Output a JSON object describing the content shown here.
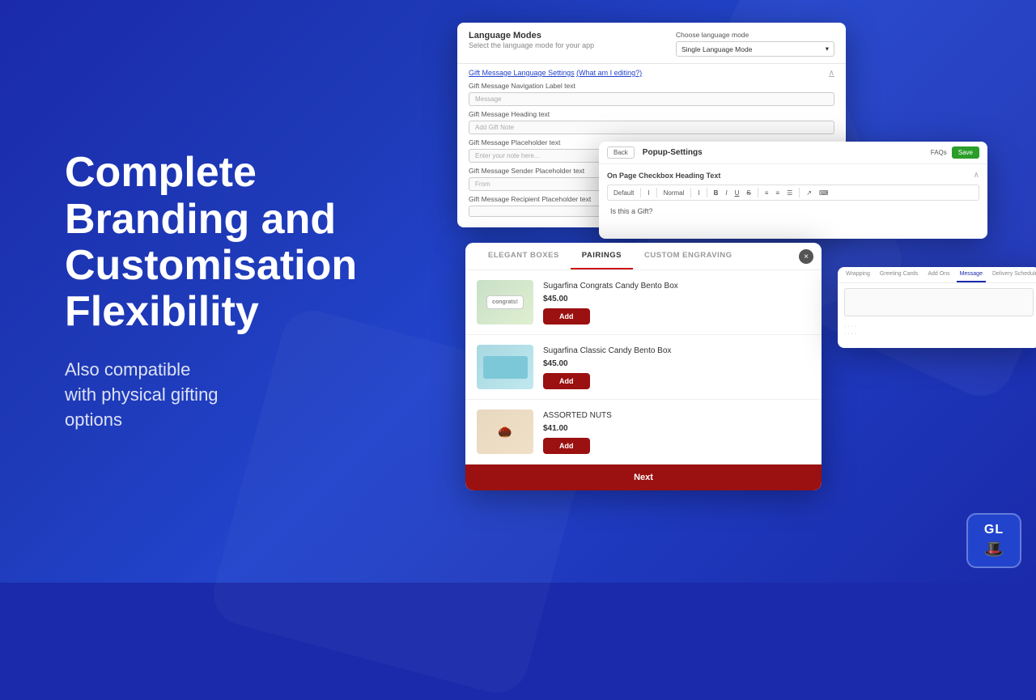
{
  "page": {
    "bg_color": "#1a2aaa"
  },
  "hero": {
    "heading": "Complete\nBranding and\nCustomisation\nFlexibility",
    "heading_line1": "Complete",
    "heading_line2": "Branding and",
    "heading_line3": "Customisation",
    "heading_line4": "Flexibility",
    "subtext_line1": "Also compatible",
    "subtext_line2": "with physical gifting",
    "subtext_line3": "options"
  },
  "language_modes_window": {
    "title": "Language Modes",
    "subtitle": "Select the language mode for your app",
    "choose_label": "Choose language mode",
    "mode_value": "Single Language Mode",
    "gift_section_title": "Gift Message Language Settings",
    "gift_link": "(What am I editing?)",
    "fields": [
      {
        "label": "Gift Message Navigation Label text",
        "placeholder": "Message"
      },
      {
        "label": "Gift Message Heading text",
        "placeholder": "Add Gift Note"
      },
      {
        "label": "Gift Message Placeholder text",
        "placeholder": "Enter your note here..."
      },
      {
        "label": "Gift Message Sender Placeholder text",
        "placeholder": "From"
      },
      {
        "label": "Gift Message Recipient Placeholder text",
        "placeholder": ""
      }
    ]
  },
  "popup_settings_window": {
    "back_label": "Back",
    "title": "Popup-Settings",
    "faqs_label": "FAQs",
    "save_label": "Save",
    "section_label": "On Page Checkbox Heading Text",
    "toolbar_items": [
      "Default",
      "I",
      "Normal",
      "I",
      "B",
      "I",
      "U",
      "S",
      "≡",
      "≡",
      "☰",
      "↗",
      "⌨"
    ],
    "checkbox_text": "Is this a Gift?"
  },
  "product_popup": {
    "tabs": [
      {
        "label": "ELEGANT BOXES",
        "active": false
      },
      {
        "label": "PAIRINGS",
        "active": true
      },
      {
        "label": "CUSTOM ENGRAVING",
        "active": false
      }
    ],
    "products": [
      {
        "name": "Sugarfina Congrats Candy Bento Box",
        "price": "$45.00",
        "add_label": "Add",
        "img_type": "congrats"
      },
      {
        "name": "Sugarfina Classic Candy Bento Box",
        "price": "$45.00",
        "add_label": "Add",
        "img_type": "classic"
      },
      {
        "name": "ASSORTED NUTS",
        "price": "$41.00",
        "add_label": "Add",
        "img_type": "nuts"
      }
    ],
    "next_label": "Next"
  },
  "small_window": {
    "tabs": [
      "Wrapping",
      "Greeting Cards",
      "Add Ons",
      "Message",
      "Delivery Schedule"
    ],
    "active_tab": "Message"
  },
  "gl_badge": {
    "text": "GL",
    "icon": "🎩"
  }
}
